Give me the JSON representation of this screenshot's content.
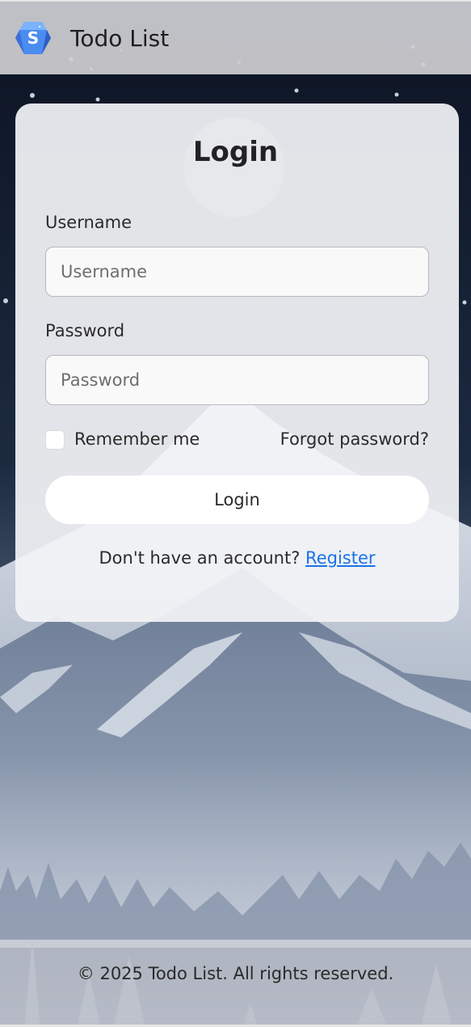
{
  "navbar": {
    "title": "Todo List",
    "logo_icon": "todo-logo-icon"
  },
  "login_card": {
    "title": "Login",
    "username_label": "Username",
    "username_placeholder": "Username",
    "username_value": "",
    "password_label": "Password",
    "password_placeholder": "Password",
    "password_value": "",
    "remember_label": "Remember me",
    "remember_checked": false,
    "forgot_label": "Forgot password?",
    "submit_label": "Login",
    "register_prompt": "Don't have an account?",
    "register_link": "Register"
  },
  "footer": {
    "text": "© 2025 Todo List. All rights reserved."
  },
  "colors": {
    "link": "#1a73e8",
    "sky": "#111a2a",
    "mountain": "#6f7f98"
  }
}
